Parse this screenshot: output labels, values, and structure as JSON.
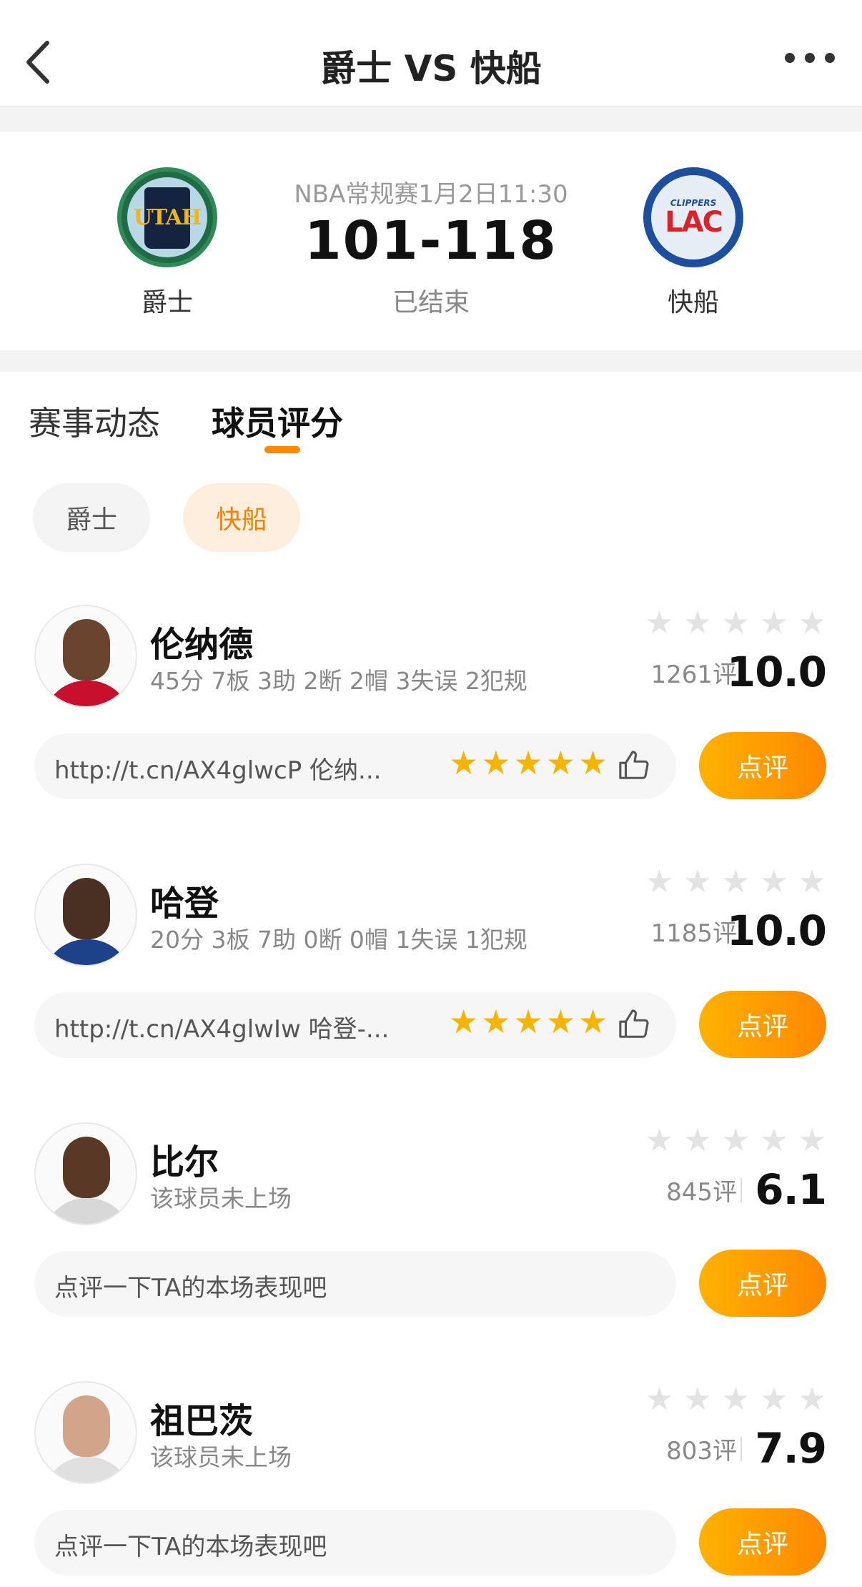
{
  "header": {
    "title": "爵士 VS 快船"
  },
  "match": {
    "league": "NBA常规赛1月2日11:30",
    "score": "101-118",
    "status": "已结束",
    "home": {
      "name": "爵士",
      "logo_text": "UTAH"
    },
    "away": {
      "name": "快船",
      "logo_small": "CLIPPERS",
      "logo_text": "LAC"
    }
  },
  "tabs": [
    {
      "label": "赛事动态",
      "active": false
    },
    {
      "label": "球员评分",
      "active": true
    }
  ],
  "filters": [
    {
      "label": "爵士",
      "active": false
    },
    {
      "label": "快船",
      "active": true
    }
  ],
  "players": [
    {
      "name": "伦纳德",
      "stats": "45分 7板 3助 2断 2帽 3失误 2犯规",
      "count": "1261评",
      "score": "10.0",
      "comment": "http://t.cn/AX4glwcP 伦纳...",
      "comment_stars": 5,
      "button": "点评"
    },
    {
      "name": "哈登",
      "stats": "20分 3板 7助 0断 0帽 1失误 1犯规",
      "count": "1185评",
      "score": "10.0",
      "comment": "http://t.cn/AX4glwIw 哈登-...",
      "comment_stars": 5,
      "button": "点评"
    },
    {
      "name": "比尔",
      "stats": "该球员未上场",
      "count": "845评",
      "score": "6.1",
      "comment": "点评一下TA的本场表现吧",
      "comment_stars": 0,
      "button": "点评"
    },
    {
      "name": "祖巴茨",
      "stats": "该球员未上场",
      "count": "803评",
      "score": "7.9",
      "comment": "点评一下TA的本场表现吧",
      "comment_stars": 0,
      "button": "点评"
    }
  ],
  "colors": {
    "accent": "#ff8a00",
    "star": "#f5b400"
  },
  "icons": {
    "back": "chevron-left-icon",
    "more": "more-dots-icon",
    "thumb": "thumbs-up-icon",
    "star": "star-icon"
  }
}
